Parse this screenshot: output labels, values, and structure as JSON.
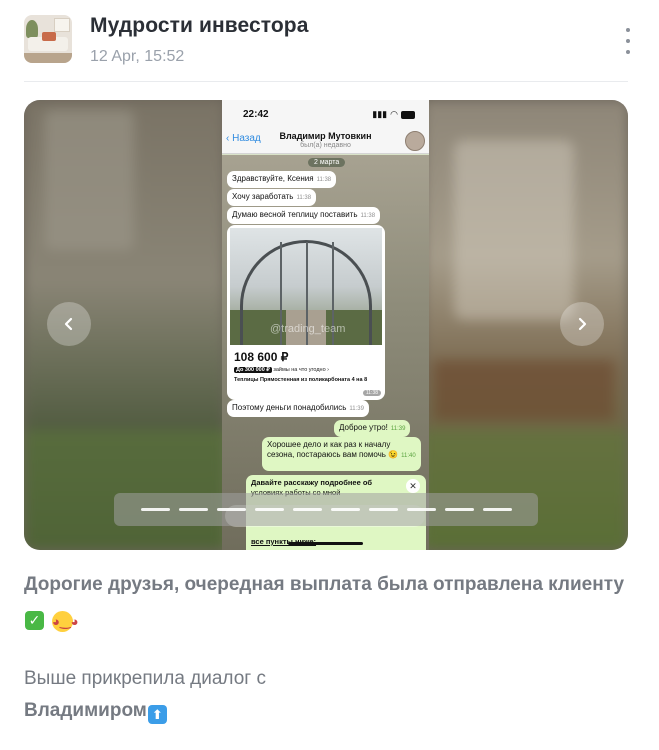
{
  "post": {
    "channel_name": "Мудрости инвестора",
    "date": "12 Apr, 15:52",
    "more_icon": "more-vertical-icon"
  },
  "carousel": {
    "prev_icon": "chevron-left-icon",
    "next_icon": "chevron-right-icon",
    "slide_count": 10,
    "active_slide": 1
  },
  "phone": {
    "status_time": "22:42",
    "back_label": "Назад",
    "contact_name": "Владимир Мутовкин",
    "contact_status": "был(а) недавно",
    "date_chip": "2 марта",
    "messages": [
      {
        "text": "Здравствуйте, Ксения",
        "time": "11:38",
        "dir": "in"
      },
      {
        "text": "Хочу заработать",
        "time": "11:38",
        "dir": "in"
      },
      {
        "text": "Думаю весной теплицу поставить",
        "time": "11:38",
        "dir": "in"
      },
      {
        "text": "Поэтому деньги понадобились",
        "time": "11:39",
        "dir": "in"
      },
      {
        "text": "Доброе утро!",
        "time": "11:39",
        "dir": "out"
      },
      {
        "text": "Хорошее дело и как раз к началу",
        "time": "",
        "dir": "out"
      },
      {
        "text": "сезона, постараюсь вам помочь 😉",
        "time": "11:40",
        "dir": "out"
      }
    ],
    "card": {
      "watermark": "@trading_team",
      "price": "108 600 ₽",
      "credit_badge": "До 300 000 ₽",
      "credit_text": "займы на что угодно",
      "description": "Теплицы Прямостенная из поликарбоната 4 на 8",
      "time": "11:38"
    },
    "long_message": {
      "line1": "Давайте расскажу подробнее об",
      "line2": "условиях работы со мной",
      "last": "все пункты ниже:"
    }
  },
  "caption": {
    "line1_text": "Дорогие друзья, очередная выплата была отправлена клиенту",
    "line1_emoji_check": "✓",
    "line1_emoji_face": "😉",
    "line2_text": "Выше прикрепила диалог с",
    "line3_text": "Владимиром",
    "line3_emoji": "⬆"
  }
}
